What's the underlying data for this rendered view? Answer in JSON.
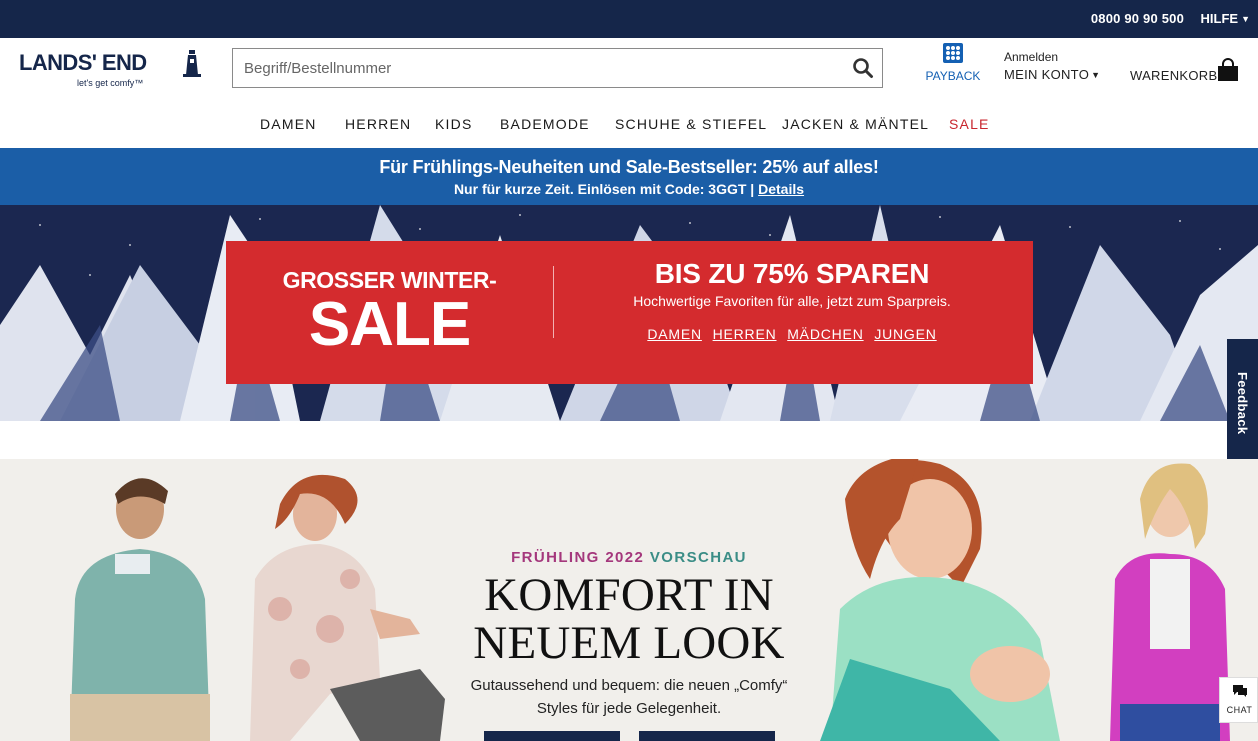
{
  "utility": {
    "phone": "0800 90 90 500",
    "help": "HILFE"
  },
  "header": {
    "logo_text": "LANDS' END",
    "logo_tagline": "let's get comfy™",
    "search_placeholder": "Begriff/Bestellnummer",
    "payback_label": "PAYBACK",
    "account_small": "Anmelden",
    "account_big": "MEIN KONTO",
    "cart_label": "WARENKORB"
  },
  "nav": {
    "items": [
      "DAMEN",
      "HERREN",
      "KIDS",
      "BADEMODE",
      "SCHUHE & STIEFEL",
      "JACKEN & MÄNTEL",
      "SALE"
    ]
  },
  "promo": {
    "line1": "Für Frühlings-Neuheiten und Sale-Bestseller: 25% auf alles!",
    "line2": "Nur für kurze Zeit. Einlösen mit Code: 3GGT |",
    "details": "Details"
  },
  "hero_sale": {
    "title_small": "GROSSER WINTER-",
    "title_big": "SALE",
    "headline": "BIS ZU 75% SPAREN",
    "subline": "Hochwertige Favoriten für alle, jetzt zum Sparpreis.",
    "links": [
      "DAMEN",
      "HERREN",
      "MÄDCHEN",
      "JUNGEN"
    ]
  },
  "feedback": {
    "label": "Feedback"
  },
  "hero_spring": {
    "eyebrow_a": "FRÜHLING 2022",
    "eyebrow_b": "VORSCHAU",
    "headline_line1": "KOMFORT IN",
    "headline_line2": "NEUEM LOOK",
    "desc_line1": "Gutaussehend und bequem: die neuen „Comfy“",
    "desc_line2": "Styles für jede Gelegenheit."
  },
  "chat": {
    "label": "CHAT"
  },
  "colors": {
    "navy": "#15264a",
    "promo_blue": "#1b5ea7",
    "sale_red": "#d42b2e",
    "nav_sale": "#c8262e",
    "eyebrow_pink": "#a4377c",
    "eyebrow_teal": "#3a8d86"
  },
  "icons": [
    "chevron-down-icon",
    "search-icon",
    "payback-icon",
    "shopping-bag-icon",
    "lighthouse-icon",
    "chat-bubble-icon"
  ]
}
